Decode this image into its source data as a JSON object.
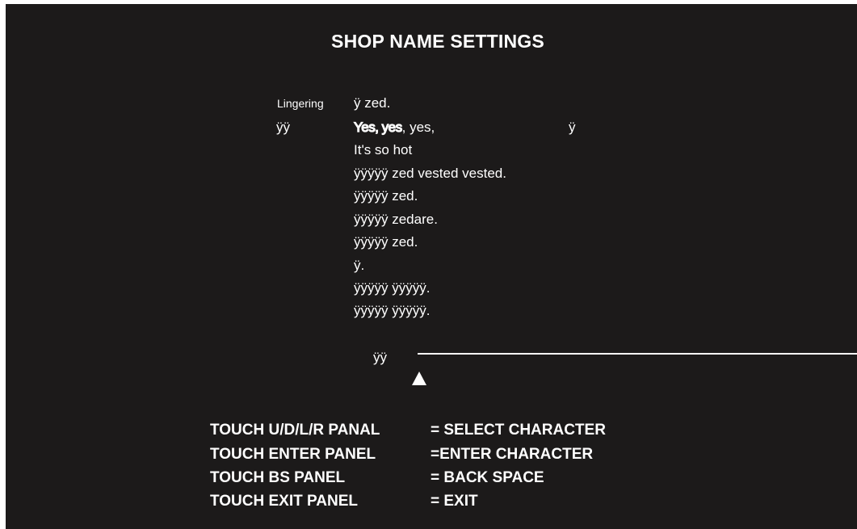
{
  "title": "SHOP NAME SETTINGS",
  "messages": {
    "label_lingering": "Lingering",
    "line1": "ÿ zed.",
    "label_left": "ÿÿ",
    "line2_emph": "Yes, yes",
    "line2_rest": ", yes,",
    "line2_right": "ÿ",
    "line3": "It's so hot",
    "line4": "ÿÿÿÿÿ zed vested vested.",
    "line5": "ÿÿÿÿÿ zed.",
    "line6": "ÿÿÿÿÿ zedare.",
    "line7": "ÿÿÿÿÿ zed.",
    "line8": "ÿ.",
    "line9": "ÿÿÿÿÿ ÿÿÿÿÿ.",
    "line10": "ÿÿÿÿÿ ÿÿÿÿÿ."
  },
  "name_entry": {
    "label": "ÿÿ",
    "value": ""
  },
  "instructions": [
    {
      "key": "TOUCH U/D/L/R PANAL",
      "action": "= SELECT CHARACTER"
    },
    {
      "key": "TOUCH ENTER PANEL",
      "action": "=ENTER CHARACTER"
    },
    {
      "key": "TOUCH BS PANEL",
      "action": "= BACK SPACE"
    },
    {
      "key": "TOUCH EXIT PANEL",
      "action": "= EXIT"
    }
  ],
  "colors": {
    "background": "#1c1a1a",
    "text": "#ffffff",
    "page_border": "#ffffff"
  },
  "icons": {
    "cursor": "up-triangle-icon"
  }
}
